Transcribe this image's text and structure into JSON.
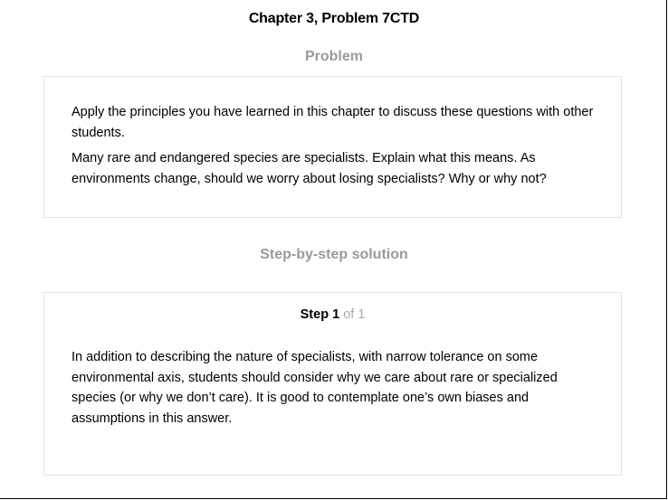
{
  "title": "Chapter 3, Problem 7CTD",
  "problem": {
    "heading": "Problem",
    "paragraphs": [
      "Apply the principles you have learned in this chapter to discuss these questions with other students.",
      "Many rare and endangered species are specialists. Explain what this means. As environments change, should we worry about losing specialists? Why or why not?"
    ]
  },
  "solution": {
    "heading": "Step-by-step solution",
    "step": {
      "word": "Step",
      "number": "1",
      "of_text": "of 1"
    },
    "body": "In addition to describing the nature of specialists, with narrow tolerance on some environmental axis, students should consider why we care about rare or specialized species (or why we don’t care). It is good to contemplate one’s own biases and assumptions in this answer."
  }
}
